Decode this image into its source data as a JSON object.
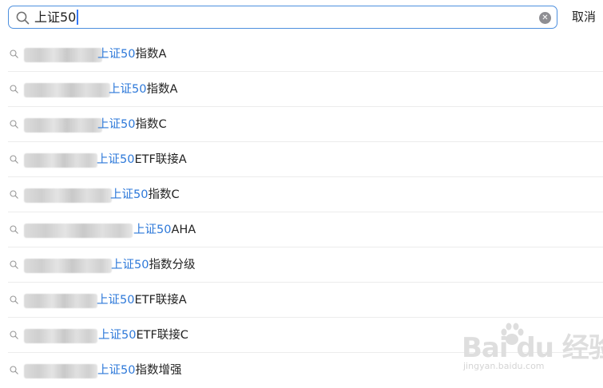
{
  "search": {
    "query": "上证50"
  },
  "header": {
    "cancel_label": "取消"
  },
  "results": [
    {
      "prefix": "上证50",
      "suffix": "指数A"
    },
    {
      "prefix": "上证50",
      "suffix": "指数A"
    },
    {
      "prefix": "上证50",
      "suffix": "指数C"
    },
    {
      "prefix": "上证50",
      "suffix": "ETF联接A"
    },
    {
      "prefix": "上证50",
      "suffix": "指数C"
    },
    {
      "prefix": "上证50",
      "suffix": "AHA"
    },
    {
      "prefix": "上证50",
      "suffix": "指数分级"
    },
    {
      "prefix": "上证50",
      "suffix": "ETF联接A"
    },
    {
      "prefix": "上证50",
      "suffix": "ETF联接C"
    },
    {
      "prefix": "上证50",
      "suffix": "指数增强"
    }
  ],
  "watermark": {
    "logo_text": "Bai du 经验",
    "url": "jingyan.baidu.com"
  },
  "colors": {
    "highlight": "#2e79d9",
    "focus_border": "#4d8fde",
    "caret": "#3478f6",
    "divider": "#ececec"
  },
  "icons": {
    "search": "search-icon",
    "clear": "clear-icon",
    "item_search": "search-icon",
    "watermark": "baidu-paw-icon"
  }
}
